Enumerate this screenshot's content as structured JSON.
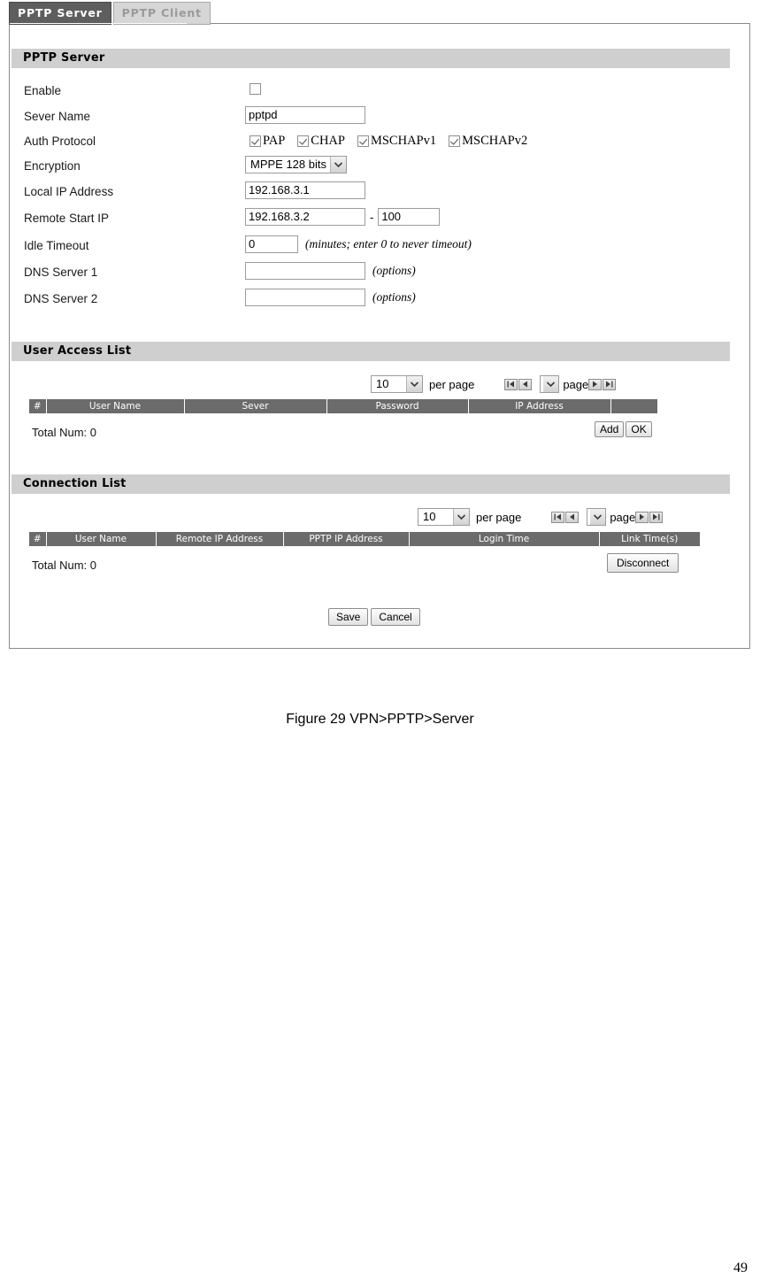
{
  "tabs": [
    {
      "label": "PPTP Server",
      "active": true
    },
    {
      "label": "PPTP Client",
      "active": false
    }
  ],
  "sections": {
    "server": {
      "title": "PPTP Server",
      "fields": {
        "enable": {
          "label": "Enable",
          "checked": false
        },
        "server_name": {
          "label": "Sever Name",
          "value": "pptpd"
        },
        "auth_protocol": {
          "label": "Auth Protocol",
          "options": [
            {
              "label": "PAP",
              "checked": true
            },
            {
              "label": "CHAP",
              "checked": true
            },
            {
              "label": "MSCHAPv1",
              "checked": true
            },
            {
              "label": "MSCHAPv2",
              "checked": true
            }
          ]
        },
        "encryption": {
          "label": "Encryption",
          "value": "MPPE 128 bits"
        },
        "local_ip": {
          "label": "Local IP Address",
          "value": "192.168.3.1"
        },
        "remote_start_ip": {
          "label": "Remote Start IP",
          "value": "192.168.3.2",
          "separator": "-",
          "end_value": "100"
        },
        "idle_timeout": {
          "label": "Idle Timeout",
          "value": "0",
          "hint": "(minutes; enter 0 to never timeout)"
        },
        "dns1": {
          "label": "DNS Server 1",
          "value": "",
          "hint": "(options)"
        },
        "dns2": {
          "label": "DNS Server 2",
          "value": "",
          "hint": "(options)"
        }
      }
    },
    "user_access_list": {
      "title": "User Access List",
      "pager": {
        "per_page_value": "10",
        "per_page_label": "per page",
        "page_value": "",
        "page_label": "page"
      },
      "columns": [
        "#",
        "User Name",
        "Sever",
        "Password",
        "IP Address",
        ""
      ],
      "rows": [],
      "total_label": "Total Num: 0",
      "buttons": [
        "Add",
        "OK"
      ]
    },
    "connection_list": {
      "title": "Connection List",
      "pager": {
        "per_page_value": "10",
        "per_page_label": "per page",
        "page_value": "",
        "page_label": "page"
      },
      "columns": [
        "#",
        "User Name",
        "Remote IP Address",
        "PPTP IP Address",
        "Login Time",
        "Link Time(s)"
      ],
      "rows": [],
      "total_label": "Total Num: 0",
      "buttons": [
        "Disconnect"
      ]
    }
  },
  "footer_buttons": {
    "save": "Save",
    "cancel": "Cancel"
  },
  "caption": "Figure 29  VPN>PPTP>Server",
  "page_number": "49",
  "colors": {
    "tab_active_bg": "#5e5e5e",
    "tab_inactive_bg": "#d6d6d6",
    "section_bar_bg": "#cfcfcf",
    "table_header_bg": "#6b6b6b",
    "panel_border": "#8a8a8a"
  }
}
